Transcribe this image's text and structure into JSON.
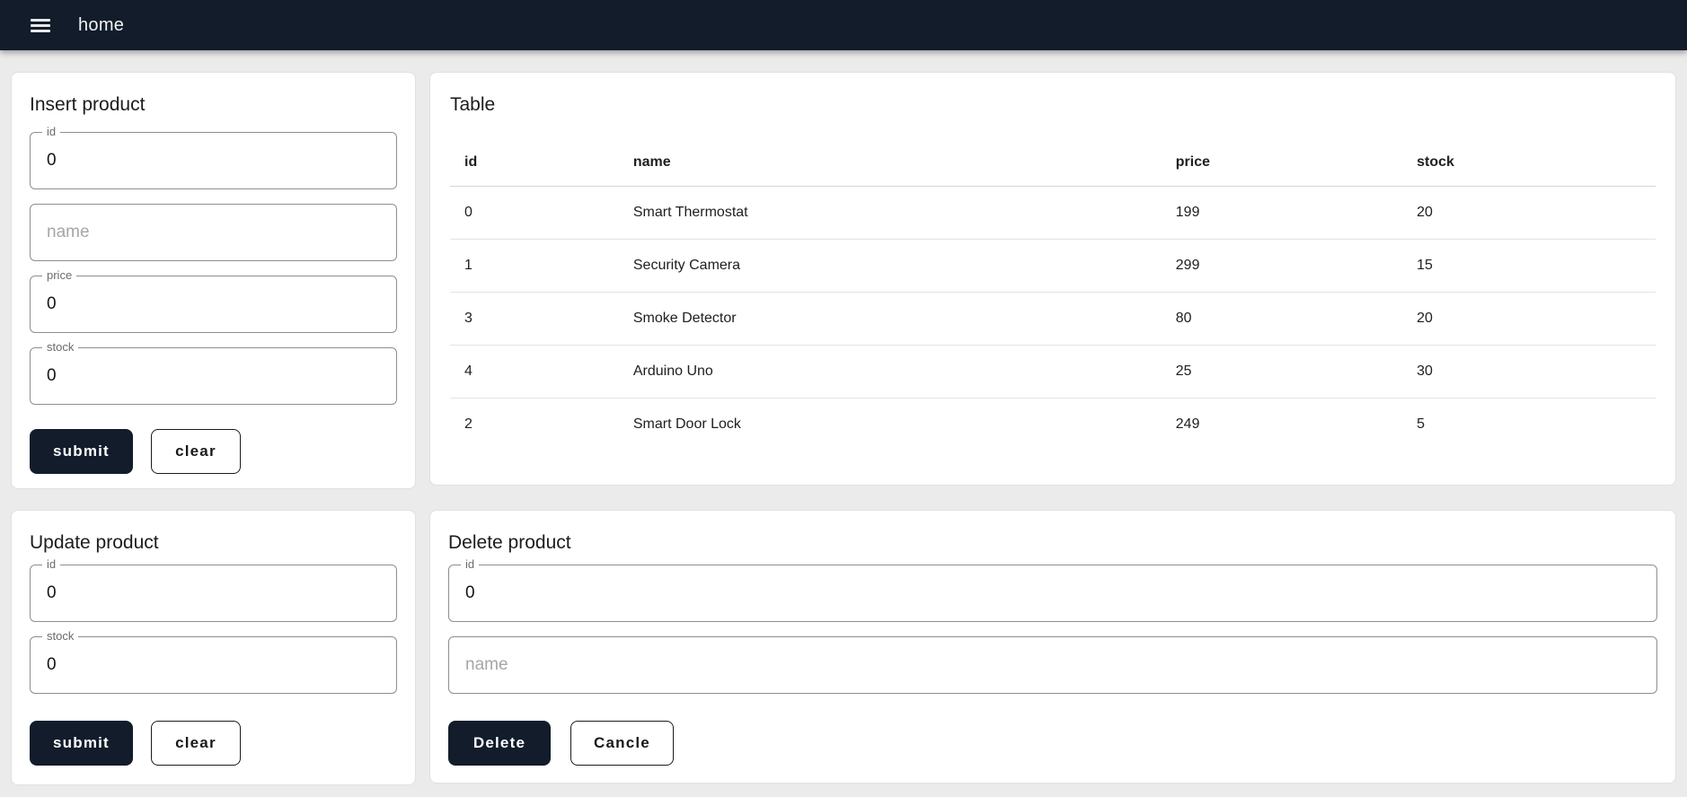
{
  "appbar": {
    "title": "home"
  },
  "colors": {
    "primary": "#121c2b",
    "page_background": "#ebebeb",
    "card_background": "#ffffff",
    "card_border": "#e0e0e0",
    "input_border": "#8e8e8e",
    "divider": "#e3e3e3",
    "label_gray": "#6b6b6b",
    "placeholder_gray": "#a6a6a6"
  },
  "insert_form": {
    "title": "Insert product",
    "fields": [
      {
        "label": "id",
        "value": "0"
      },
      {
        "placeholder": "name",
        "value": ""
      },
      {
        "label": "price",
        "value": "0"
      },
      {
        "label": "stock",
        "value": "0"
      }
    ],
    "submit_label": "submit",
    "clear_label": "clear"
  },
  "table_card": {
    "title": "Table",
    "columns": [
      "id",
      "name",
      "price",
      "stock"
    ],
    "rows": [
      [
        "0",
        "Smart Thermostat",
        "199",
        "20"
      ],
      [
        "1",
        "Security Camera",
        "299",
        "15"
      ],
      [
        "3",
        "Smoke Detector",
        "80",
        "20"
      ],
      [
        "4",
        "Arduino Uno",
        "25",
        "30"
      ],
      [
        "2",
        "Smart Door Lock",
        "249",
        "5"
      ]
    ]
  },
  "update_form": {
    "title": "Update product",
    "fields": [
      {
        "label": "id",
        "value": "0"
      },
      {
        "label": "stock",
        "value": "0"
      }
    ],
    "submit_label": "submit",
    "clear_label": "clear"
  },
  "delete_form": {
    "title": "Delete product",
    "fields": [
      {
        "label": "id",
        "value": "0"
      },
      {
        "placeholder": "name",
        "value": ""
      }
    ],
    "delete_label": "Delete",
    "cancel_label": "Cancle"
  }
}
